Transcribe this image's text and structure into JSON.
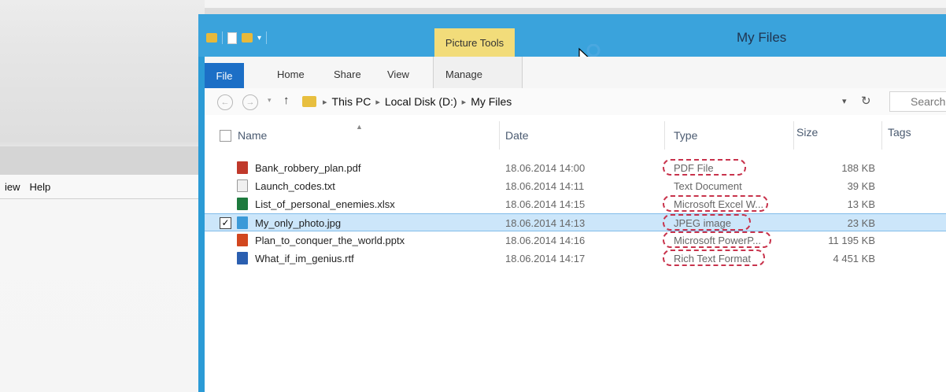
{
  "background_window": {
    "menu": [
      "iew",
      "Help"
    ]
  },
  "window": {
    "title": "My Files",
    "context_tab": "Picture Tools",
    "ribbon_tabs": [
      "File",
      "Home",
      "Share",
      "View",
      "Manage"
    ]
  },
  "address": {
    "crumbs": [
      "This PC",
      "Local Disk (D:)",
      "My Files"
    ],
    "search_placeholder": "Search"
  },
  "columns": [
    "Name",
    "Date",
    "Type",
    "Size",
    "Tags"
  ],
  "files": [
    {
      "name": "Bank_robbery_plan.pdf",
      "date": "18.06.2014 14:00",
      "type": "PDF File",
      "size": "188 KB",
      "icon": "pdf-icon",
      "color": "#c0392b"
    },
    {
      "name": "Launch_codes.txt",
      "date": "18.06.2014 14:11",
      "type": "Text Document",
      "size": "39 KB",
      "icon": "text-file-icon",
      "color": "#f0f0f0"
    },
    {
      "name": "List_of_personal_enemies.xlsx",
      "date": "18.06.2014 14:15",
      "type": "Microsoft Excel W...",
      "size": "13 KB",
      "icon": "excel-icon",
      "color": "#1d7a3e"
    },
    {
      "name": "My_only_photo.jpg",
      "date": "18.06.2014 14:13",
      "type": "JPEG image",
      "size": "23 KB",
      "icon": "image-icon",
      "color": "#3b9ad8",
      "selected": true
    },
    {
      "name": "Plan_to_conquer_the_world.pptx",
      "date": "18.06.2014 14:16",
      "type": "Microsoft PowerP...",
      "size": "11 195 KB",
      "icon": "powerpoint-icon",
      "color": "#d2471f"
    },
    {
      "name": "What_if_im_genius.rtf",
      "date": "18.06.2014 14:17",
      "type": "Rich Text Format",
      "size": "4 451 KB",
      "icon": "rtf-icon",
      "color": "#2b5fb0"
    }
  ],
  "colors": {
    "titlebar": "#3aa3dc",
    "file_tab": "#1c6fc6",
    "context_tab": "#f2dc7a",
    "selection": "#cce6fa",
    "annotation": "#c8334c"
  }
}
